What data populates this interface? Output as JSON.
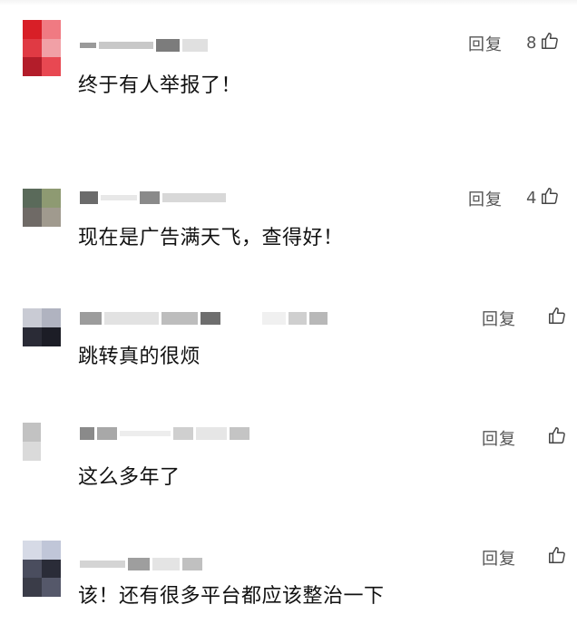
{
  "comments": [
    {
      "username": "",
      "text": "终于有人举报了！",
      "reply_label": "回复",
      "likes": "8"
    },
    {
      "username": "",
      "text": "现在是广告满天飞，查得好！",
      "reply_label": "回复",
      "likes": "4"
    },
    {
      "username": "",
      "text": "跳转真的很烦",
      "reply_label": "回复",
      "likes": ""
    },
    {
      "username": "",
      "text": "这么多年了",
      "reply_label": "回复",
      "likes": ""
    },
    {
      "username": "",
      "text": "该！还有很多平台都应该整治一下",
      "reply_label": "回复",
      "likes": ""
    }
  ],
  "icons": {
    "like": "thumbs-up-icon",
    "avatar": "pixelated-avatar"
  },
  "colors": {
    "text": "#111111",
    "meta": "#555555",
    "avatar1": [
      "#d8242b",
      "#e8505a",
      "#c31f2a",
      "#ef6670",
      "#b5202d",
      "#e33e48"
    ]
  }
}
